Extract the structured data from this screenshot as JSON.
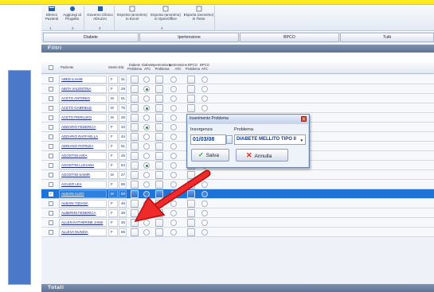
{
  "ribbon": {
    "buttons": [
      {
        "label1": "Elenco",
        "label2": "Pazienti"
      },
      {
        "label1": "Aggiungi al",
        "label2": "Progetto"
      },
      {
        "label1": "Governo Clinico",
        "label2": "Abruzzo"
      },
      {
        "label1": "Esporta (anonimo)",
        "label2": "in Excel"
      },
      {
        "label1": "Esporta (anonimo)",
        "label2": "in OpenOffice"
      },
      {
        "label1": "Esporta (anonimo)",
        "label2": "in Testo"
      }
    ],
    "group_numbers": [
      "1",
      "2",
      "3",
      "4"
    ]
  },
  "tabs": [
    "Diabete",
    "Ipertensione",
    "BPCO",
    "Tutti"
  ],
  "filters_title": "Filtri",
  "totals_title": "Totali",
  "columns": {
    "paziente": "Paziente",
    "sesso": "Sesso",
    "eta": "Età",
    "c1": [
      "Diabete",
      "Problema"
    ],
    "c2": [
      "Diabete",
      "ATC"
    ],
    "c3": [
      "Ipertensione",
      "Problema"
    ],
    "c4": [
      "Ipertensione",
      "ATC"
    ],
    "c5": [
      "BPCO",
      "Problema"
    ],
    "c6": [
      "BPCO",
      "ATC"
    ]
  },
  "rows": [
    {
      "name": "ABED ILHAM",
      "sex": "F",
      "age": "31",
      "d_atc": false
    },
    {
      "name": "ABITA VALENTINA",
      "sex": "F",
      "age": "29",
      "d_atc": true
    },
    {
      "name": "ACETO ANTONIO",
      "sex": "M",
      "age": "51",
      "d_atc": false
    },
    {
      "name": "ACETO GABRIELE",
      "sex": "M",
      "age": "75",
      "d_atc": true
    },
    {
      "name": "ACETO PIERLUIGI",
      "sex": "M",
      "age": "26",
      "d_atc": false
    },
    {
      "name": "ADDARIO FEDERICA",
      "sex": "F",
      "age": "33",
      "d_atc": true
    },
    {
      "name": "ADDARIO RAFFAELLA",
      "sex": "F",
      "age": "34",
      "d_atc": false
    },
    {
      "name": "ADRIANO PATRIZIA",
      "sex": "F",
      "age": "51",
      "d_atc": false
    },
    {
      "name": "AGOSTINI IARA",
      "sex": "F",
      "age": "25",
      "d_atc": false
    },
    {
      "name": "AGOSTINI LUCIANA",
      "sex": "F",
      "age": "64",
      "d_atc": true
    },
    {
      "name": "AGOSTINI SAMIR",
      "sex": "M",
      "age": "27",
      "d_atc": false
    },
    {
      "name": "AGUZZI LEA",
      "sex": "F",
      "age": "89",
      "d_atc": false
    },
    {
      "name": "ALBANI ALDO",
      "sex": "M",
      "age": "69",
      "d_atc": false,
      "selected": true
    },
    {
      "name": "ALBANI TIZIANA",
      "sex": "F",
      "age": "46",
      "d_atc": true
    },
    {
      "name": "ALBERINI FEDERICA",
      "sex": "F",
      "age": "38",
      "d_atc": false
    },
    {
      "name": "ALLEN KATHERINE JANE",
      "sex": "F",
      "age": "45",
      "d_atc": false
    },
    {
      "name": "ALLEVA NUNZIA",
      "sex": "F",
      "age": "59",
      "d_atc": false
    }
  ],
  "dialog": {
    "title": "Inserimento Problema",
    "label_date": "Insorgenza",
    "label_problem": "Problema",
    "date_value": "01/03/08",
    "problem_value": "DIABETE MELLITO TIPO II",
    "save_label": "Salva",
    "cancel_label": "Annulla",
    "close_glyph": "x"
  },
  "colors": {
    "accent": "#1f72d6",
    "header_bar": "#6a7fa2",
    "arrow": "#e01b1b",
    "left_panel": "#4b78c9"
  }
}
